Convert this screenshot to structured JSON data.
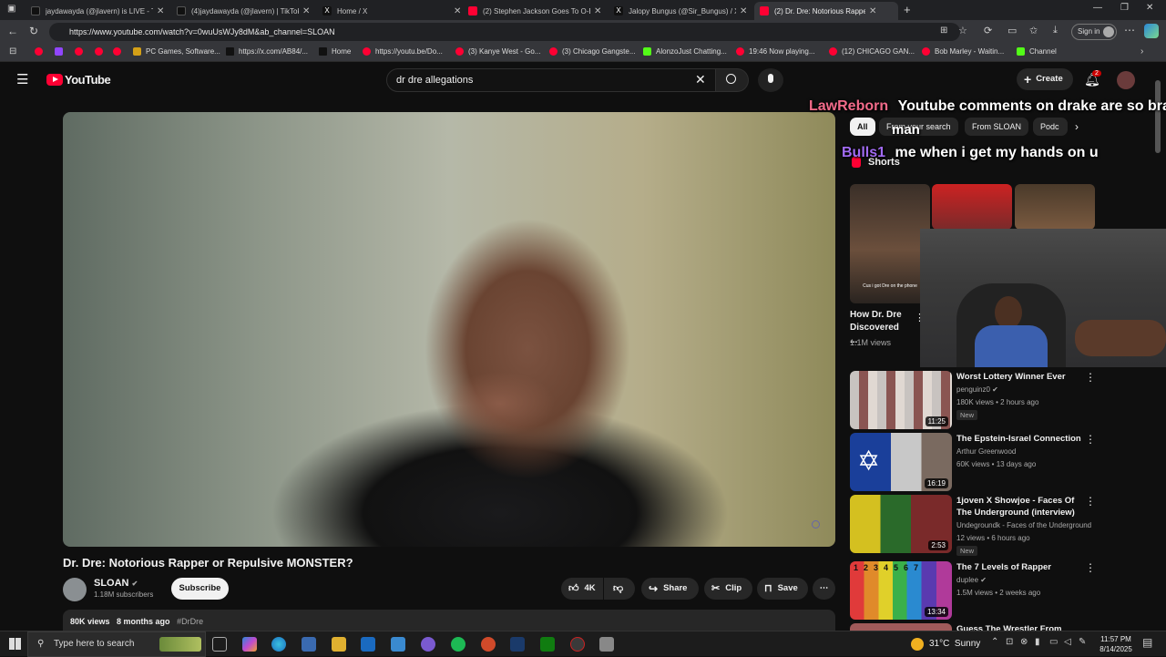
{
  "browser": {
    "tabs": [
      {
        "title": "jaydawayda (@jlavern) is LIVE - TikTok",
        "color": "#111"
      },
      {
        "title": "(4)jaydawayda (@jlavern) | TikTok",
        "color": "#111"
      },
      {
        "title": "Home / X",
        "color": "#111"
      },
      {
        "title": "(2) Stephen Jackson Goes To O-Bl",
        "color": "#ff0033"
      },
      {
        "title": "Jalopy Bungus (@Sir_Bungus) / X",
        "color": "#111"
      },
      {
        "title": "(2) Dr. Dre: Notorious Rappe",
        "color": "#ff0033"
      }
    ],
    "url": "https://www.youtube.com/watch?v=0wuUsWJy8dM&ab_channel=SLOAN",
    "sign_in": "Sign in",
    "bookmarks": [
      {
        "label": "",
        "color": "#ff0033"
      },
      {
        "label": "",
        "color": "#9146ff"
      },
      {
        "label": "",
        "color": "#ff0033"
      },
      {
        "label": "",
        "color": "#ff0033"
      },
      {
        "label": "",
        "color": "#ff0033"
      },
      {
        "label": "PC Games, Software...",
        "color": "#d4a017"
      },
      {
        "label": "https://x.com/AB84/...",
        "color": "#111"
      },
      {
        "label": "Home",
        "color": "#111"
      },
      {
        "label": "https://youtu.be/Do...",
        "color": "#ff0033"
      },
      {
        "label": "(3) Kanye West - Go...",
        "color": "#ff0033"
      },
      {
        "label": "(3) Chicago Gangste...",
        "color": "#ff0033"
      },
      {
        "label": "AlonzoJust Chatting...",
        "color": "#53fc18"
      },
      {
        "label": "19:46 Now playing...",
        "color": "#ff0033"
      },
      {
        "label": "(12) CHICAGO GAN...",
        "color": "#ff0033"
      },
      {
        "label": "Bob Marley - Waitin...",
        "color": "#ff0033"
      },
      {
        "label": "Channel",
        "color": "#53fc18"
      }
    ]
  },
  "youtube": {
    "logo": "YouTube",
    "search_query": "dr dre allegations",
    "create_label": "Create",
    "notif_count": "2",
    "video": {
      "title": "Dr. Dre: Notorious Rapper or Repulsive MONSTER?",
      "channel": "SLOAN",
      "subscribers": "1.18M subscribers",
      "subscribe": "Subscribe",
      "likes": "4K",
      "share": "Share",
      "clip": "Clip",
      "save": "Save",
      "views": "80K views",
      "age": "8 months ago",
      "hashtag": "#DrDre"
    },
    "chips": [
      "All",
      "From your search",
      "From SLOAN",
      "Podc"
    ],
    "shorts_label": "Shorts",
    "short": {
      "title": "How Dr. Dre Discovered ...",
      "views": "1.1M views",
      "caption": "Cus i got Dre on the phone"
    },
    "recommendations": [
      {
        "title": "Worst Lottery Winner Ever",
        "channel": "penguinz0",
        "meta": "180K views • 2 hours ago",
        "badge": "New",
        "duration": "11:25"
      },
      {
        "title": "The Epstein-Israel Connection",
        "channel": "Arthur Greenwood",
        "meta": "60K views • 13 days ago",
        "badge": "",
        "duration": "16:19"
      },
      {
        "title": "1joven X Showjoe - Faces Of The Underground (interview)",
        "channel": "Undegroundk - Faces of the Underground",
        "meta": "12 views • 6 hours ago",
        "badge": "New",
        "duration": "2:53"
      },
      {
        "title": "The 7 Levels of Rapper",
        "channel": "duplee",
        "meta": "1.5M views • 2 weeks ago",
        "badge": "",
        "duration": "13:34"
      },
      {
        "title": "Guess The Wrestler From Their",
        "channel": "",
        "meta": "",
        "badge": "",
        "duration": ""
      }
    ]
  },
  "stream_overlay": {
    "chat1_user": "LawReborn",
    "chat1_msg": "Youtube comments on drake are so brain",
    "chat1_msg2": "man",
    "chat2_user": "Bulls1",
    "chat2_msg": "me when i get my hands on u"
  },
  "taskbar": {
    "search_placeholder": "Type here to search",
    "weather": "31°C  Sunny",
    "time": "11:57 PM",
    "date": "8/14/2025"
  }
}
